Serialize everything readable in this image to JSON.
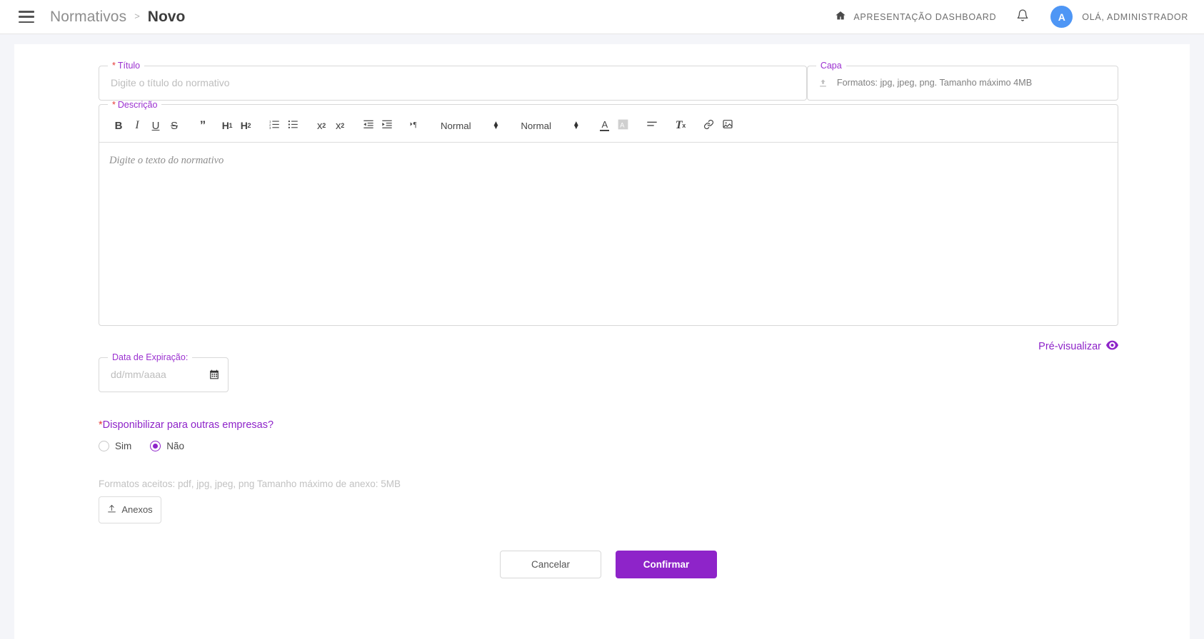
{
  "topbar": {
    "menu_icon": "hamburger-icon",
    "breadcrumb_root": "Normativos",
    "breadcrumb_separator": ">",
    "breadcrumb_current": "Novo",
    "dashboard_label": "APRESENTAÇÃO DASHBOARD",
    "home_icon": "home-icon",
    "bell_icon": "bell-icon",
    "avatar_initial": "A",
    "greeting": "OLÁ, ADMINISTRADOR",
    "avatar_color": "#4e96f5"
  },
  "form": {
    "titulo": {
      "label": "Título",
      "required_mark": "*",
      "placeholder": "Digite o título do normativo",
      "value": ""
    },
    "capa": {
      "label": "Capa",
      "upload_icon": "upload-icon",
      "hint": "Formatos: jpg, jpeg, png. Tamanho máximo 4MB"
    },
    "descricao": {
      "label": "Descrição",
      "required_mark": "*",
      "placeholder": "Digite o texto do normativo",
      "value": "",
      "toolbar": {
        "bold": "B",
        "italic": "I",
        "underline": "U",
        "strike": "S",
        "blockquote": "”",
        "h1": "H",
        "h1_sub": "1",
        "h2": "H",
        "h2_sub": "2",
        "ordered_list": "ordered-list-icon",
        "bullet_list": "bullet-list-icon",
        "subscript": "x",
        "subscript_sub": "2",
        "superscript": "x",
        "superscript_sup": "2",
        "outdent": "outdent-icon",
        "indent": "indent-icon",
        "direction": "text-direction-icon",
        "font_size": "Normal",
        "heading_style": "Normal",
        "text_color": "A",
        "highlight_color": "A",
        "align": "align-icon",
        "clear_format": "T",
        "clear_format_sub": "x",
        "link": "link-icon",
        "image": "image-icon"
      }
    },
    "preview": {
      "label": "Pré-visualizar",
      "icon": "eye-icon"
    },
    "expiracao": {
      "label": "Data de Expiração:",
      "placeholder": "dd/mm/aaaa",
      "value": "",
      "calendar_icon": "calendar-icon"
    },
    "disponibilizar": {
      "required_mark": "*",
      "question": "Disponibilizar para outras empresas?",
      "options": [
        {
          "label": "Sim",
          "value": "sim",
          "selected": false
        },
        {
          "label": "Não",
          "value": "nao",
          "selected": true
        }
      ]
    },
    "anexos": {
      "note": "Formatos aceitos: pdf, jpg, jpeg, png Tamanho máximo de anexo: 5MB",
      "button_label": "Anexos",
      "button_icon": "upload-icon"
    },
    "actions": {
      "cancel_label": "Cancelar",
      "confirm_label": "Confirmar"
    }
  },
  "colors": {
    "accent": "#8e24c9",
    "required": "#e53935",
    "page_bg": "#f4f5f9"
  }
}
